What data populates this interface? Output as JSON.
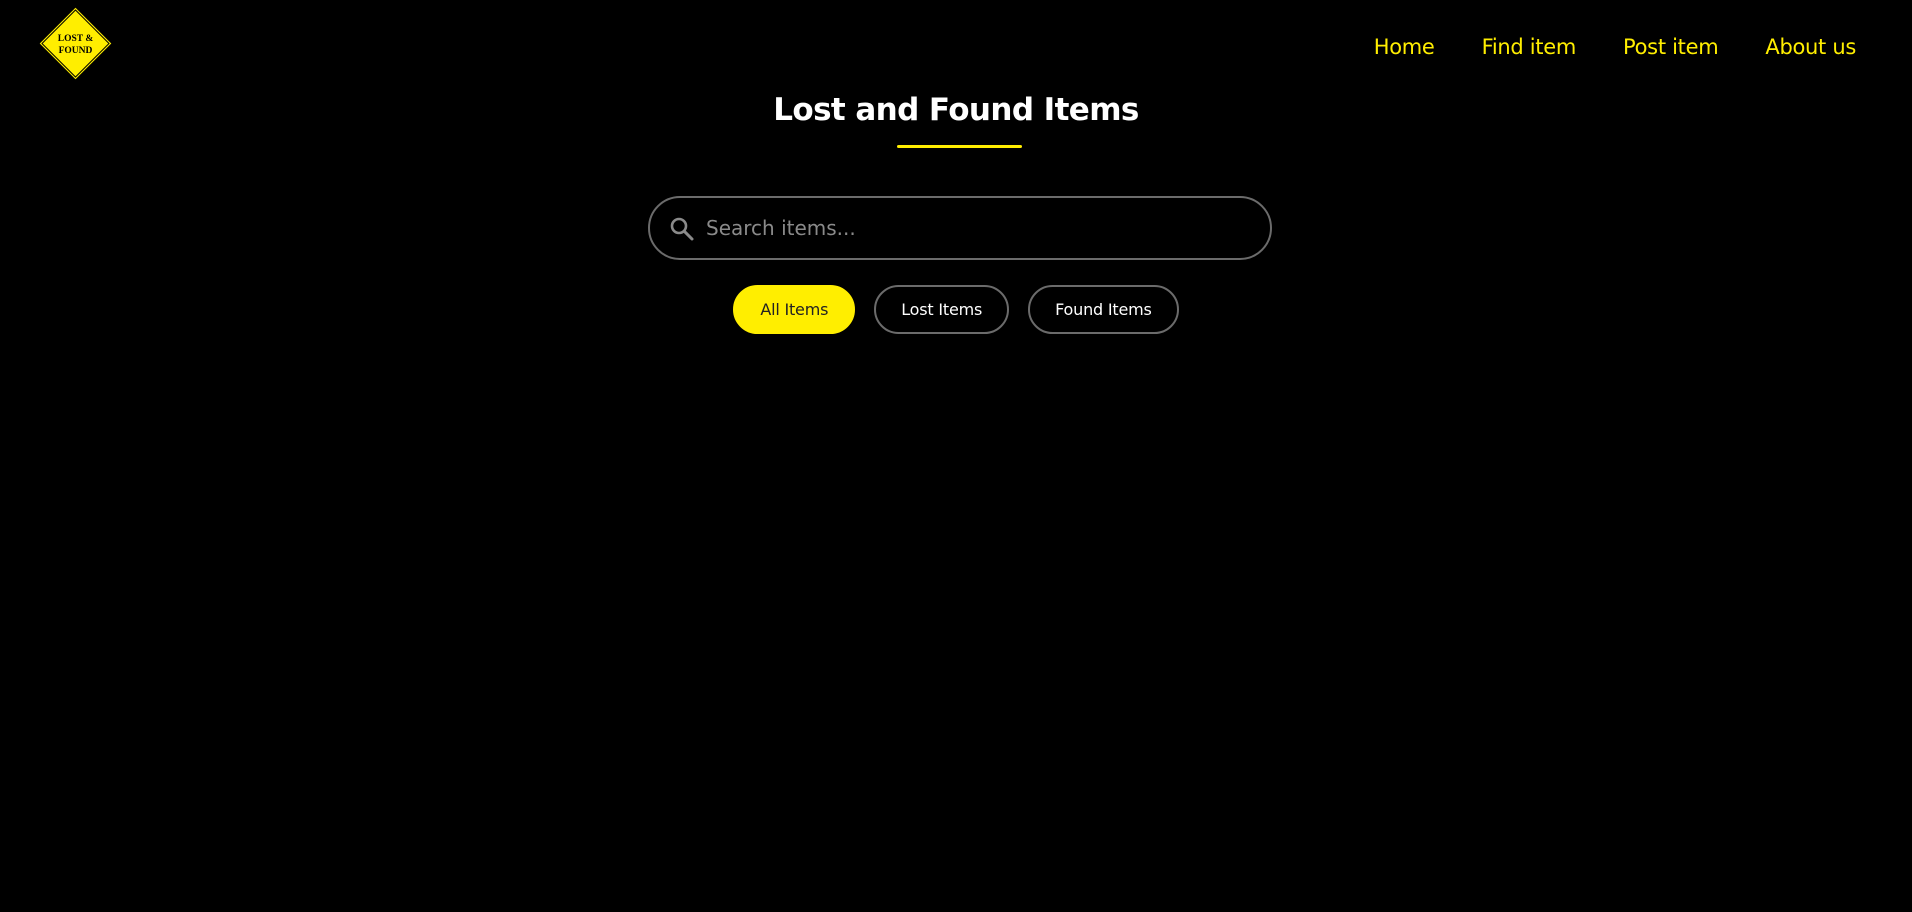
{
  "logo": {
    "line1": "LOST &",
    "line2": "FOUND",
    "color": "#ffee00"
  },
  "nav": {
    "items": [
      {
        "label": "Home"
      },
      {
        "label": "Find item"
      },
      {
        "label": "Post item"
      },
      {
        "label": "About us"
      }
    ]
  },
  "main": {
    "title": "Lost and Found Items"
  },
  "search": {
    "placeholder": "Search items...",
    "icon": "search-icon"
  },
  "filters": {
    "items": [
      {
        "label": "All Items",
        "active": true
      },
      {
        "label": "Lost Items",
        "active": false
      },
      {
        "label": "Found Items",
        "active": false
      }
    ]
  },
  "colors": {
    "accent": "#ffee00",
    "background": "#000000",
    "border": "#6b6b6b"
  }
}
